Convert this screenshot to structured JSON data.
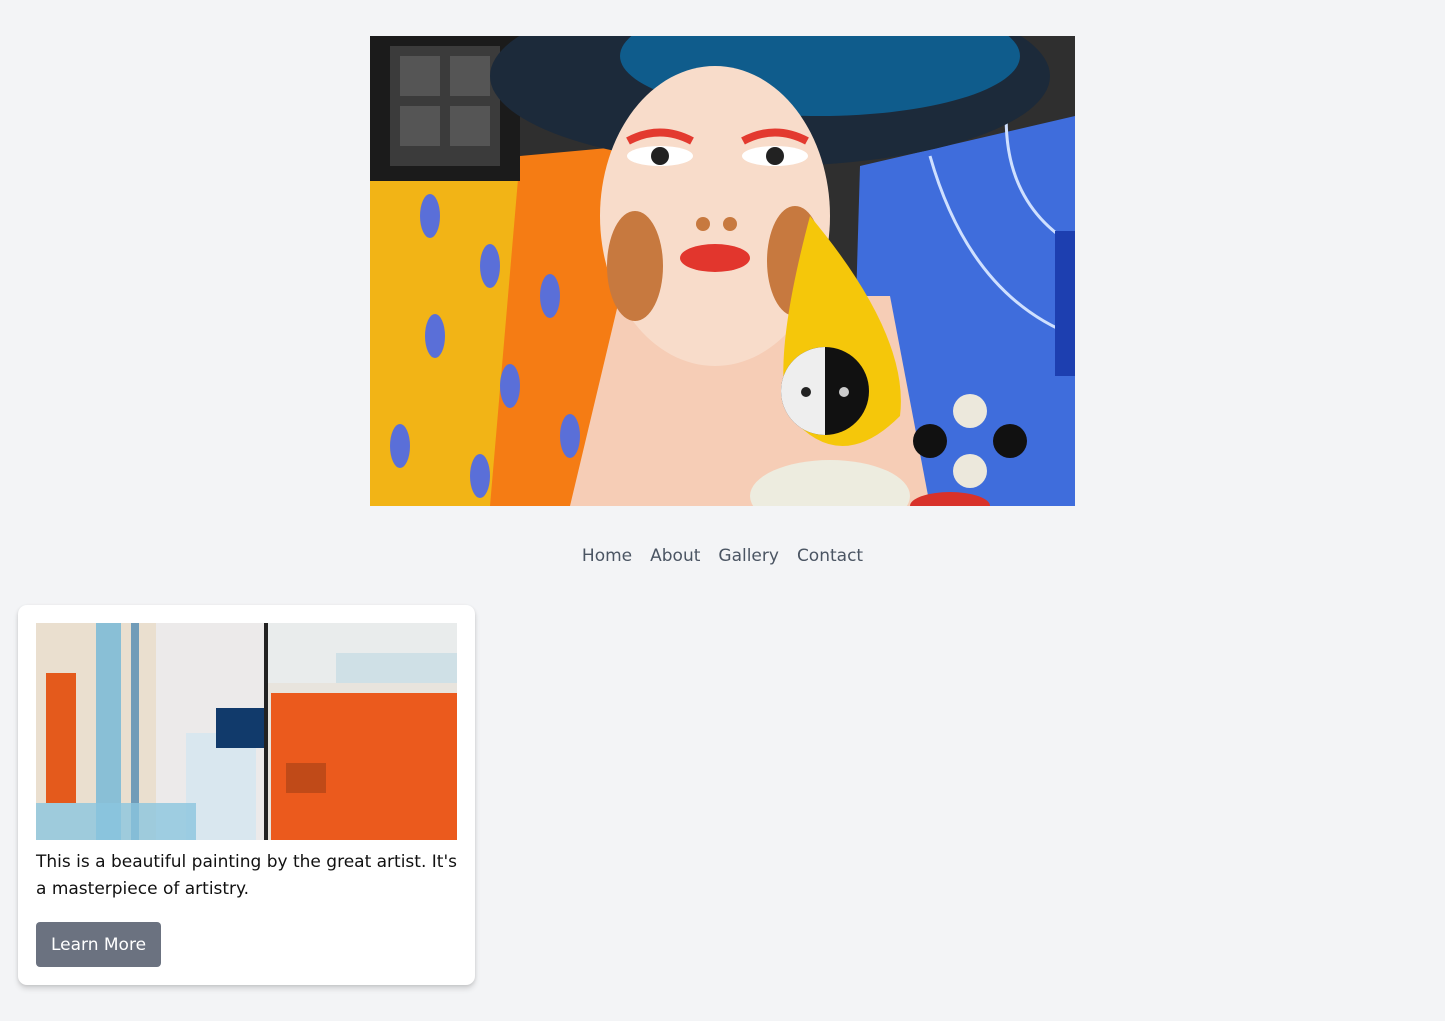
{
  "hero": {
    "image_semantic": "colorful-portrait-painting"
  },
  "nav": {
    "items": [
      {
        "label": "Home"
      },
      {
        "label": "About"
      },
      {
        "label": "Gallery"
      },
      {
        "label": "Contact"
      }
    ]
  },
  "card": {
    "image_semantic": "abstract-painting-thumbnail",
    "description": "This is a beautiful painting by the great artist. It's a masterpiece of artistry.",
    "button_label": "Learn More"
  },
  "colors": {
    "page_background": "#f3f4f6",
    "card_background": "#ffffff",
    "button_background": "#6b7280",
    "button_text": "#ffffff",
    "nav_text": "#4b5563"
  }
}
